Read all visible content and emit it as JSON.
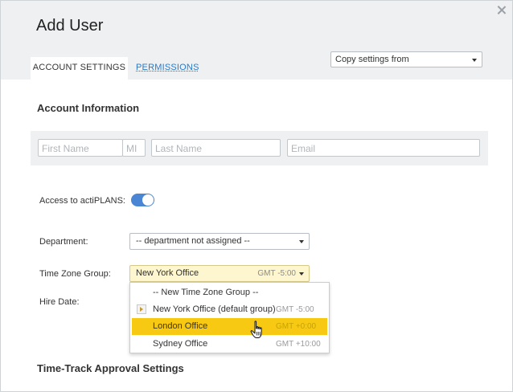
{
  "dialog": {
    "title": "Add User",
    "close_icon": "close-icon"
  },
  "tabs": [
    {
      "label": "ACCOUNT SETTINGS",
      "active": true
    },
    {
      "label": "PERMISSIONS",
      "active": false
    }
  ],
  "copy_settings": {
    "value": "Copy settings from"
  },
  "account_info": {
    "title": "Account Information",
    "first_name_placeholder": "First Name",
    "mi_placeholder": "MI",
    "last_name_placeholder": "Last Name",
    "email_placeholder": "Email"
  },
  "access": {
    "label": "Access to actiPLANS:",
    "enabled": true
  },
  "department": {
    "label": "Department:",
    "value": "-- department not assigned --"
  },
  "time_zone": {
    "label": "Time Zone Group:",
    "value": "New York Office",
    "gmt": "GMT -5:00",
    "options": [
      {
        "label": "-- New Time Zone Group --",
        "gmt": ""
      },
      {
        "label": "New York Office (default group)",
        "gmt": "GMT -5:00"
      },
      {
        "label": "London Office",
        "gmt": "GMT +0:00"
      },
      {
        "label": "Sydney Office",
        "gmt": "GMT +10:00"
      }
    ]
  },
  "hire_date": {
    "label": "Hire Date:"
  },
  "approval": {
    "title": "Time-Track Approval Settings"
  },
  "colors": {
    "accent": "#4a86d4",
    "highlight": "#f7c912",
    "link": "#2b7ac6"
  }
}
